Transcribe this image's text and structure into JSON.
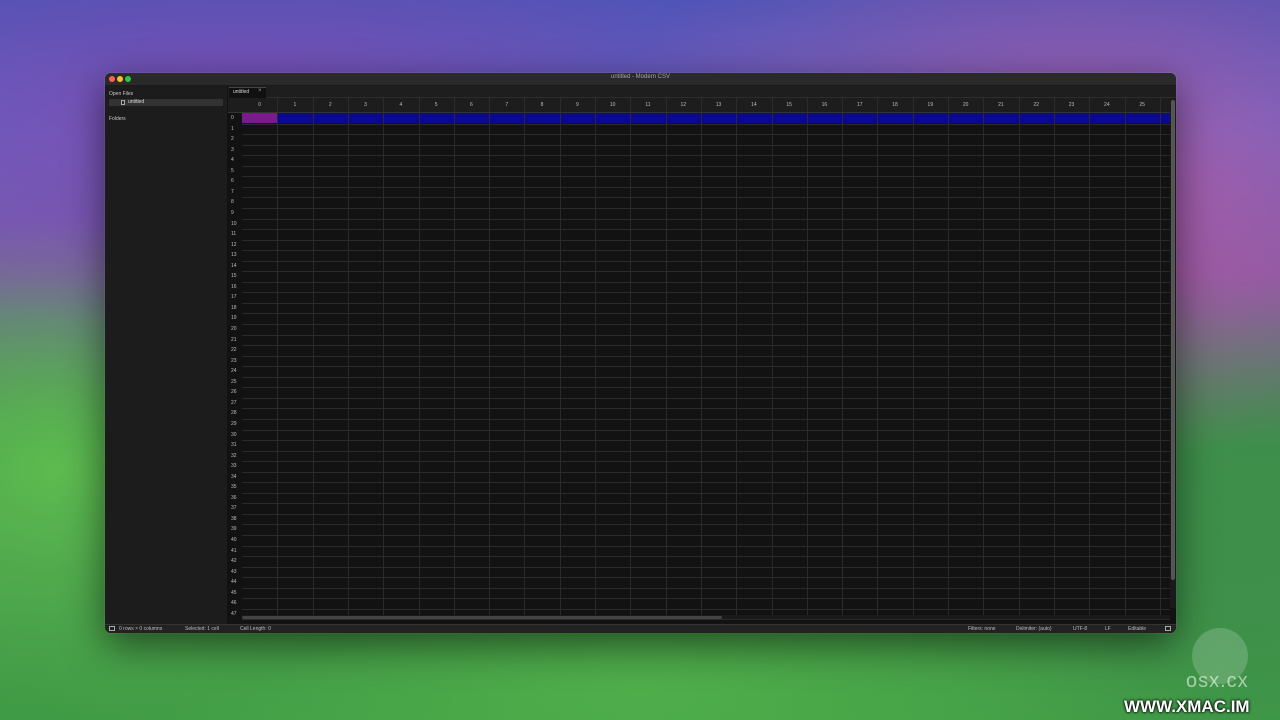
{
  "window": {
    "title": "untitled - Modern CSV"
  },
  "sidebar": {
    "open_files_label": "Open Files",
    "files": [
      {
        "label": "untitled"
      }
    ],
    "folders_label": "Folders"
  },
  "tabs": [
    {
      "label": "untitled",
      "close": "×"
    }
  ],
  "grid": {
    "columns": [
      "0",
      "1",
      "2",
      "3",
      "4",
      "5",
      "6",
      "7",
      "8",
      "9",
      "10",
      "11",
      "12",
      "13",
      "14",
      "15",
      "16",
      "17",
      "18",
      "19",
      "20",
      "21",
      "22",
      "23",
      "24",
      "25"
    ],
    "rows": [
      "0",
      "1",
      "2",
      "3",
      "4",
      "5",
      "6",
      "7",
      "8",
      "9",
      "10",
      "11",
      "12",
      "13",
      "14",
      "15",
      "16",
      "17",
      "18",
      "19",
      "20",
      "21",
      "22",
      "23",
      "24",
      "25",
      "26",
      "27",
      "28",
      "29",
      "30",
      "31",
      "32",
      "33",
      "34",
      "35",
      "36",
      "37",
      "38",
      "39",
      "40",
      "41",
      "42",
      "43",
      "44",
      "45",
      "46",
      "47"
    ],
    "selected_row_index": 0,
    "selected_col_index": 0
  },
  "status": {
    "size": "0 rows × 0 columns",
    "selected": "Selected: 1 cell",
    "cell_length": "Cell Length: 0",
    "filters": "Filters: none",
    "delimiter": "Delimiter: (auto)",
    "encoding": "UTF-8",
    "line_ending": "LF",
    "mode": "Editable"
  },
  "watermark": {
    "brand": "osx.cx",
    "url": "WWW.XMAC.IM"
  },
  "colors": {
    "selected_row": "#0a0a8c",
    "selected_cell": "#7a1a8c",
    "grid_background": "#121212"
  }
}
